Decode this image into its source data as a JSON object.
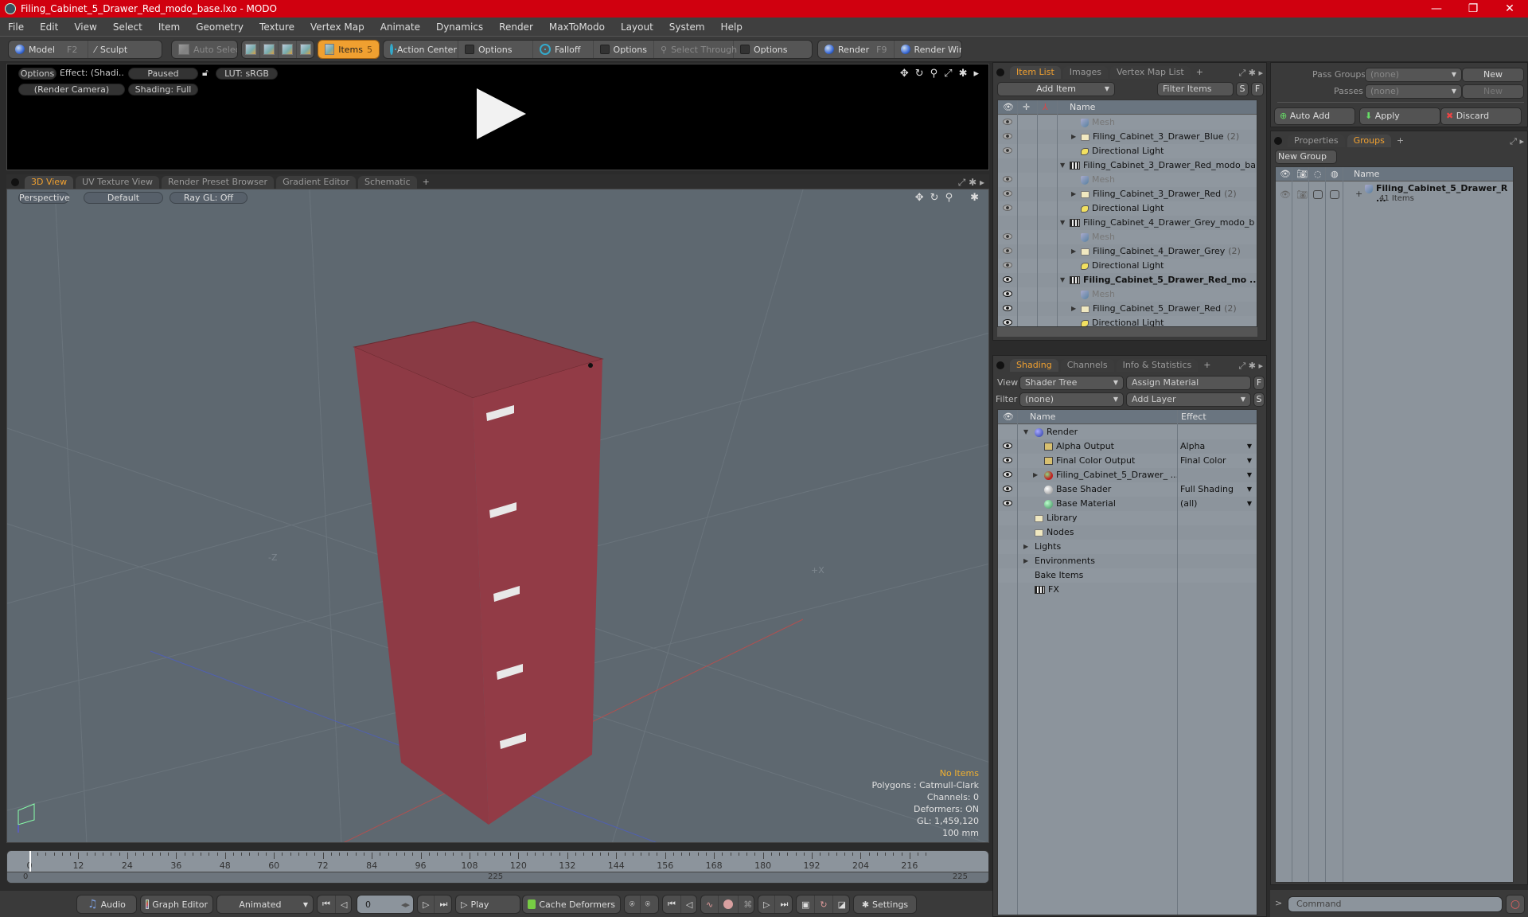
{
  "window": {
    "title": "Filing_Cabinet_5_Drawer_Red_modo_base.lxo - MODO",
    "controls": [
      "—",
      "❐",
      "✕"
    ]
  },
  "menu": [
    "File",
    "Edit",
    "View",
    "Select",
    "Item",
    "Geometry",
    "Texture",
    "Vertex Map",
    "Animate",
    "Dynamics",
    "Render",
    "MaxToModo",
    "Layout",
    "System",
    "Help"
  ],
  "toolbar": {
    "model": "Model",
    "model_key": "F2",
    "sculpt": "Sculpt",
    "auto_select": "Auto Select",
    "items": "Items",
    "items_key": "5",
    "action_center": "Action Center",
    "options1": "Options",
    "falloff": "Falloff",
    "options2": "Options",
    "select_through": "Select Through",
    "options3": "Options",
    "render": "Render",
    "render_key": "F9",
    "render_window": "Render Window"
  },
  "render_preview": {
    "options": "Options",
    "effect": "Effect: (Shadi...",
    "status": "Paused",
    "lut": "LUT: sRGB",
    "camera": "(Render Camera)",
    "shading": "Shading: Full"
  },
  "viewport_tabs": [
    "3D View",
    "UV Texture View",
    "Render Preset Browser",
    "Gradient Editor",
    "Schematic",
    "+"
  ],
  "viewport": {
    "projection": "Perspective",
    "style": "Default",
    "raygl": "Ray GL: Off",
    "axis_neg_z": "-Z",
    "axis_pos_x": "+X",
    "stats": {
      "selection": "No Items",
      "polygons": "Polygons : Catmull-Clark",
      "channels": "Channels: 0",
      "deformers": "Deformers: ON",
      "gl": "GL: 1,459,120",
      "grid": "100 mm"
    },
    "object_color": "#8c3a44"
  },
  "timeline": {
    "ticks": [
      "0",
      "12",
      "24",
      "36",
      "48",
      "60",
      "72",
      "84",
      "96",
      "108",
      "120",
      "132",
      "144",
      "156",
      "168",
      "180",
      "192",
      "204",
      "216"
    ],
    "range_start": "0",
    "range_end": "225",
    "current_frame": 0,
    "max_frame": 225
  },
  "transport": {
    "audio": "Audio",
    "graph_editor": "Graph Editor",
    "animated": "Animated",
    "frame": "0",
    "play": "Play",
    "cache_deformers": "Cache Deformers",
    "settings": "Settings"
  },
  "item_list": {
    "tabs": [
      "Item List",
      "Images",
      "Vertex Map List",
      "+"
    ],
    "add_item": "Add Item",
    "filter_placeholder": "Filter Items",
    "s_btn": "S",
    "f_btn": "F",
    "col_name": "Name",
    "rows": [
      {
        "indent": 2,
        "icon": "mesh",
        "label": "Mesh",
        "dim": true,
        "eye": "dim"
      },
      {
        "indent": 2,
        "icon": "folder",
        "label": "Filing_Cabinet_3_Drawer_Blue",
        "count": "(2)",
        "expand": "▶",
        "eye": "dim"
      },
      {
        "indent": 2,
        "icon": "light",
        "label": "Directional Light",
        "eye": "dim"
      },
      {
        "indent": 1,
        "icon": "scene",
        "label": "Filing_Cabinet_3_Drawer_Red_modo_ba ...",
        "expand": "▼",
        "eye": "none"
      },
      {
        "indent": 2,
        "icon": "mesh",
        "label": "Mesh",
        "dim": true,
        "eye": "dim"
      },
      {
        "indent": 2,
        "icon": "folder",
        "label": "Filing_Cabinet_3_Drawer_Red",
        "count": "(2)",
        "expand": "▶",
        "eye": "dim"
      },
      {
        "indent": 2,
        "icon": "light",
        "label": "Directional Light",
        "eye": "dim"
      },
      {
        "indent": 1,
        "icon": "scene",
        "label": "Filing_Cabinet_4_Drawer_Grey_modo_b ...",
        "expand": "▼",
        "eye": "none"
      },
      {
        "indent": 2,
        "icon": "mesh",
        "label": "Mesh",
        "dim": true,
        "eye": "dim"
      },
      {
        "indent": 2,
        "icon": "folder",
        "label": "Filing_Cabinet_4_Drawer_Grey",
        "count": "(2)",
        "expand": "▶",
        "eye": "dim"
      },
      {
        "indent": 2,
        "icon": "light",
        "label": "Directional Light",
        "eye": "dim"
      },
      {
        "indent": 1,
        "icon": "scene",
        "label": "Filing_Cabinet_5_Drawer_Red_mo ...",
        "expand": "▼",
        "bold": true,
        "eye": "on"
      },
      {
        "indent": 2,
        "icon": "mesh",
        "label": "Mesh",
        "dim": true,
        "eye": "on"
      },
      {
        "indent": 2,
        "icon": "folder",
        "label": "Filing_Cabinet_5_Drawer_Red",
        "count": "(2)",
        "expand": "▶",
        "eye": "on"
      },
      {
        "indent": 2,
        "icon": "light",
        "label": "Directional Light",
        "eye": "on"
      }
    ]
  },
  "shading": {
    "tabs": [
      "Shading",
      "Channels",
      "Info & Statistics",
      "+"
    ],
    "view_label": "View",
    "view_value": "Shader Tree",
    "assign_material": "Assign Material",
    "f_btn": "F",
    "filter_label": "Filter",
    "filter_value": "(none)",
    "add_layer": "Add Layer",
    "s_btn": "S",
    "col_name": "Name",
    "col_effect": "Effect",
    "rows": [
      {
        "indent": 0,
        "icon": "ball-blue",
        "label": "Render",
        "expand": "▼",
        "effect": "",
        "eye": false
      },
      {
        "indent": 1,
        "icon": "img",
        "label": "Alpha Output",
        "effect": "Alpha",
        "eye": true,
        "dd": true
      },
      {
        "indent": 1,
        "icon": "img",
        "label": "Final Color Output",
        "effect": "Final Color",
        "eye": true,
        "dd": true
      },
      {
        "indent": 1,
        "icon": "ball-red",
        "label": "Filing_Cabinet_5_Drawer_ ...",
        "expand": "▶",
        "effect": "",
        "eye": true,
        "dd": true
      },
      {
        "indent": 1,
        "icon": "ball-white",
        "label": "Base Shader",
        "effect": "Full Shading",
        "eye": true,
        "dd": true
      },
      {
        "indent": 1,
        "icon": "ball-green",
        "label": "Base Material",
        "effect": "(all)",
        "eye": true,
        "dd": true
      },
      {
        "indent": 0,
        "icon": "folder",
        "label": "Library",
        "effect": "",
        "eye": false
      },
      {
        "indent": 0,
        "icon": "folder",
        "label": "Nodes",
        "effect": "",
        "eye": false
      },
      {
        "indent": 0,
        "icon": "none",
        "label": "Lights",
        "expand": "▶",
        "effect": "",
        "eye": false
      },
      {
        "indent": 0,
        "icon": "none",
        "label": "Environments",
        "expand": "▶",
        "effect": "",
        "eye": false
      },
      {
        "indent": 0,
        "icon": "none",
        "label": "Bake Items",
        "effect": "",
        "eye": false
      },
      {
        "indent": 0,
        "icon": "scene",
        "label": "FX",
        "effect": "",
        "eye": false
      }
    ]
  },
  "passes": {
    "pass_groups_label": "Pass Groups",
    "pass_groups_value": "(none)",
    "passes_label": "Passes",
    "passes_value": "(none)",
    "new1": "New",
    "new2": "New",
    "auto_add": "Auto Add",
    "apply": "Apply",
    "discard": "Discard"
  },
  "groups": {
    "tabs": [
      "Properties",
      "Groups",
      "+"
    ],
    "new_group": "New Group",
    "col_name": "Name",
    "group_name": "Filing_Cabinet_5_Drawer_R ...",
    "group_count": "41 Items"
  },
  "command": {
    "prompt": ">",
    "placeholder": "Command"
  }
}
